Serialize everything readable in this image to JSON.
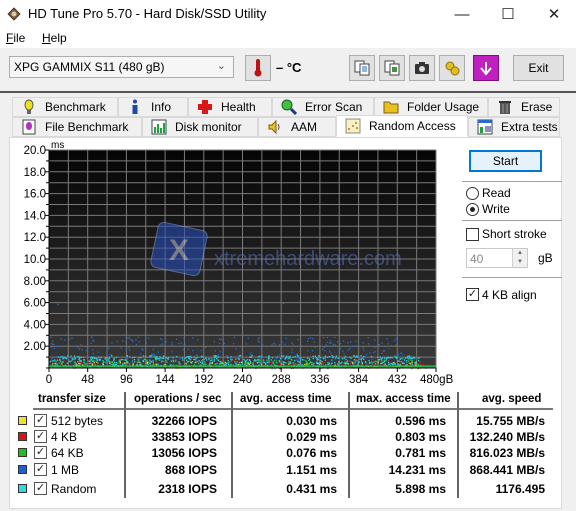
{
  "window": {
    "title": "HD Tune Pro 5.70 - Hard Disk/SSD Utility",
    "controls": {
      "minimize": "—",
      "maximize": "☐",
      "close": "✕"
    }
  },
  "menu": {
    "items": [
      {
        "label": "File",
        "accel": "F",
        "rest": "ile"
      },
      {
        "label": "Help",
        "accel": "H",
        "rest": "elp"
      }
    ]
  },
  "toolbar": {
    "drive": "XPG GAMMIX S11 (480 gB)",
    "temperature": "– °C",
    "buttons": [
      "copy-text-icon",
      "copy-screenshot-icon",
      "camera-icon",
      "options-icon",
      "save-down-icon"
    ],
    "exit_label": "Exit"
  },
  "tabs": {
    "row1": [
      {
        "label": "Benchmark",
        "icon": "lightbulb-icon"
      },
      {
        "label": "Info",
        "icon": "info-icon"
      },
      {
        "label": "Health",
        "icon": "health-cross-icon"
      },
      {
        "label": "Error Scan",
        "icon": "magnifier-icon"
      },
      {
        "label": "Folder Usage",
        "icon": "folder-icon"
      },
      {
        "label": "Erase",
        "icon": "trash-icon"
      }
    ],
    "row2": [
      {
        "label": "File Benchmark",
        "icon": "file-benchmark-icon"
      },
      {
        "label": "Disk monitor",
        "icon": "disk-monitor-icon"
      },
      {
        "label": "AAM",
        "icon": "speaker-icon"
      },
      {
        "label": "Random Access",
        "icon": "random-access-icon",
        "active": true
      },
      {
        "label": "Extra tests",
        "icon": "extra-tests-icon"
      }
    ]
  },
  "controls": {
    "start_label": "Start",
    "read_label": "Read",
    "write_label": "Write",
    "mode": "Write",
    "short_stroke_label": "Short stroke",
    "short_stroke_checked": false,
    "short_stroke_value": "40",
    "short_stroke_unit": "gB",
    "align_label": "4 KB align",
    "align_checked": true
  },
  "watermark": "xtremehardware.com",
  "chart_data": {
    "type": "scatter",
    "title": "",
    "xlabel": "gB",
    "ylabel": "ms",
    "xlim": [
      0,
      480
    ],
    "ylim": [
      0,
      20
    ],
    "x_ticks": [
      "0",
      "48",
      "96",
      "144",
      "192",
      "240",
      "288",
      "336",
      "384",
      "432",
      "480gB"
    ],
    "y_ticks": [
      "20.0",
      "18.0",
      "16.0",
      "14.0",
      "12.0",
      "10.0",
      "8.00",
      "6.00",
      "4.00",
      "2.00"
    ],
    "grid": true,
    "background": "#000000",
    "series": [
      {
        "name": "512 bytes",
        "color": "#f0e030",
        "y_range_ms": [
          0.0,
          0.6
        ],
        "x_extent_gb": 470
      },
      {
        "name": "4 KB",
        "color": "#d02020",
        "y_range_ms": [
          0.0,
          0.8
        ],
        "x_extent_gb": 470
      },
      {
        "name": "64 KB",
        "color": "#20c040",
        "y_range_ms": [
          0.0,
          0.8
        ],
        "x_extent_gb": 470
      },
      {
        "name": "1 MB",
        "color": "#2070d0",
        "y_range_ms": [
          1.0,
          2.8
        ],
        "x_extent_gb": 440,
        "outliers": [
          [
            10,
            5.9
          ],
          [
            290,
            6.0
          ]
        ]
      },
      {
        "name": "Random",
        "color": "#30d0e0",
        "y_range_ms": [
          0.1,
          1.2
        ],
        "x_extent_gb": 460
      }
    ]
  },
  "results": {
    "headers": [
      "transfer size",
      "operations / sec",
      "avg. access time",
      "max. access time",
      "avg. speed"
    ],
    "rows": [
      {
        "color": "#f0e030",
        "checked": true,
        "size": "512 bytes",
        "ops": "32266 IOPS",
        "avg": "0.030 ms",
        "max": "0.596 ms",
        "speed": "15.755 MB/s"
      },
      {
        "color": "#d01818",
        "checked": true,
        "size": "4 KB",
        "ops": "33853 IOPS",
        "avg": "0.029 ms",
        "max": "0.803 ms",
        "speed": "132.240 MB/s"
      },
      {
        "color": "#20c020",
        "checked": true,
        "size": "64 KB",
        "ops": "13056 IOPS",
        "avg": "0.076 ms",
        "max": "0.781 ms",
        "speed": "816.023 MB/s"
      },
      {
        "color": "#2060d0",
        "checked": true,
        "size": "1 MB",
        "ops": "868 IOPS",
        "avg": "1.151 ms",
        "max": "14.231 ms",
        "speed": "868.441 MB/s"
      },
      {
        "color": "#30d8e0",
        "checked": true,
        "size": "Random",
        "ops": "2318 IOPS",
        "avg": "0.431 ms",
        "max": "5.898 ms",
        "speed": "1176.495"
      }
    ]
  }
}
